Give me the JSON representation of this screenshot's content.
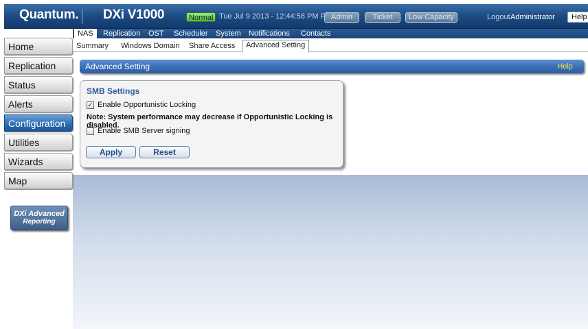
{
  "header": {
    "logo": "Quantum.",
    "product": "DXi V1000",
    "status": "Normal",
    "datetime": "Tue Jul 9 2013 - 12:44:58 PM PDT",
    "buttons": {
      "admin": "Admin",
      "ticket": "Ticket",
      "low_capacity": "Low Capacity"
    },
    "logout": "Logout",
    "user": "Administrator",
    "help": "Help ▾"
  },
  "nav": {
    "items": [
      "Home",
      "Replication",
      "Status",
      "Alerts",
      "Configuration",
      "Utilities",
      "Wizards",
      "Map"
    ],
    "active": "Configuration",
    "dxi_card": {
      "line1": "DXi Advanced",
      "line2": "Reporting"
    }
  },
  "tabs_primary": [
    "NAS",
    "Replication",
    "OST",
    "Scheduler",
    "System",
    "Notifications",
    "Contacts"
  ],
  "tabs_secondary": [
    "Summary",
    "Windows Domain",
    "Share Access",
    "Advanced Setting"
  ],
  "section": {
    "title": "Advanced Setting",
    "help": "Help"
  },
  "smb": {
    "title": "SMB Settings",
    "oplock_label": "Enable Opportunistic Locking",
    "oplock_checked": true,
    "note": "Note: System performance may decrease if Opportunistic Locking is disabled.",
    "signing_label": "Enable SMB Server signing",
    "signing_checked": false,
    "apply": "Apply",
    "reset": "Reset"
  },
  "colors": {
    "header_blue": "#1f4d86",
    "nav_active": "#2f6fb5",
    "status_green": "#55b842",
    "help_yellow": "#f2e34a",
    "panel_title": "#2f5d9b"
  }
}
